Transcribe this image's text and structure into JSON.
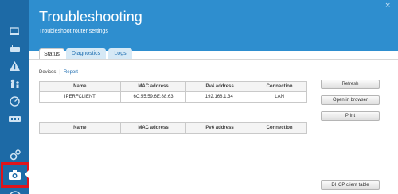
{
  "header": {
    "title": "Troubleshooting",
    "subtitle": "Troubleshoot router settings",
    "close_icon": "×"
  },
  "tabs": [
    {
      "label": "Status",
      "active": true
    },
    {
      "label": "Diagnostics",
      "active": false
    },
    {
      "label": "Logs",
      "active": false
    }
  ],
  "devices": {
    "label": "Devices",
    "separator": "|",
    "report_link": "Report"
  },
  "ipv4_table": {
    "columns": [
      "Name",
      "MAC address",
      "IPv4 address",
      "Connection"
    ],
    "rows": [
      [
        "IPERFCLIENT",
        "6C:55:59:6E:88:63",
        "192.168.1.34",
        "LAN"
      ]
    ]
  },
  "ipv6_table": {
    "columns": [
      "Name",
      "MAC address",
      "IPv6 address",
      "Connection"
    ],
    "rows": []
  },
  "actions": {
    "refresh": "Refresh",
    "open_in_browser": "Open in browser",
    "print": "Print",
    "dhcp_client_table": "DHCP client table"
  },
  "sidebar": {
    "icons": [
      "devices-icon",
      "router-icon",
      "alert-icon",
      "parental-controls-icon",
      "speed-icon",
      "network-map-icon",
      "settings-icon",
      "troubleshooting-icon",
      "wifi-icon"
    ],
    "active": "troubleshooting-icon"
  },
  "colors": {
    "sidebar": "#1d6aa6",
    "header": "#2e8ecf",
    "tab_inactive": "#d6e9f6",
    "link": "#1f6eb0",
    "active_highlight": "#e0141b"
  }
}
